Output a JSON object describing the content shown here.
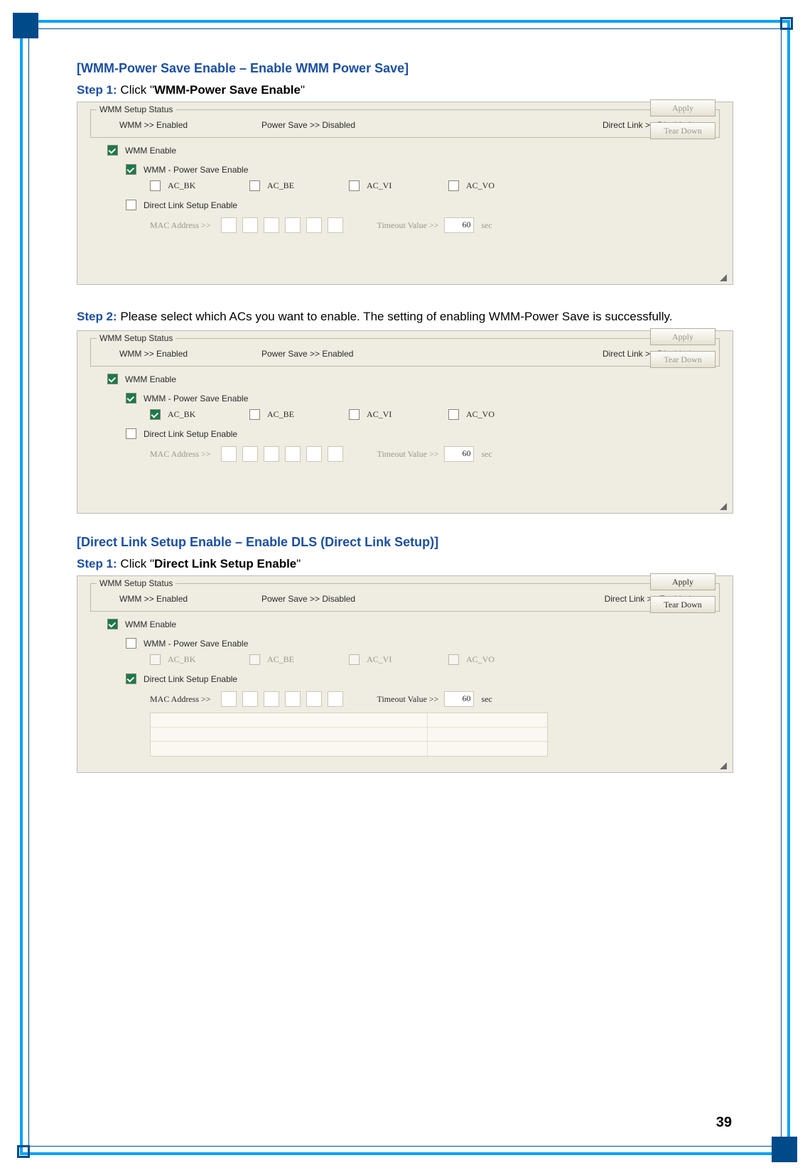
{
  "sectionA": {
    "heading": "[WMM-Power Save Enable – Enable WMM Power Save]",
    "step1_label": "Step 1:",
    "step1_normal": " Click \"",
    "step1_bold": "WMM-Power Save Enable",
    "step1_after": "\""
  },
  "panel1": {
    "group": "WMM Setup Status",
    "wmm": "WMM >> Enabled",
    "ps": "Power Save >> Disabled",
    "dl": "Direct Link >> Disabled",
    "wmm_enable": "WMM Enable",
    "ps_enable": "WMM - Power Save Enable",
    "ac_bk": "AC_BK",
    "ac_be": "AC_BE",
    "ac_vi": "AC_VI",
    "ac_vo": "AC_VO",
    "dls_enable": "Direct Link Setup Enable",
    "mac_label": "MAC Address >>",
    "tv_label": "Timeout Value >>",
    "tv_val": "60",
    "sec": "sec",
    "apply": "Apply",
    "tear": "Tear Down"
  },
  "step2_text_prefix": "Step 2:",
  "step2_text_rest": " Please select which ACs you want to enable. The setting of enabling WMM-Power Save is successfully.",
  "panel2": {
    "group": "WMM Setup Status",
    "wmm": "WMM >> Enabled",
    "ps": "Power Save >> Enabled",
    "dl": "Direct Link >> Disabled",
    "wmm_enable": "WMM Enable",
    "ps_enable": "WMM - Power Save Enable",
    "ac_bk": "AC_BK",
    "ac_be": "AC_BE",
    "ac_vi": "AC_VI",
    "ac_vo": "AC_VO",
    "dls_enable": "Direct Link Setup Enable",
    "mac_label": "MAC Address >>",
    "tv_label": "Timeout Value >>",
    "tv_val": "60",
    "sec": "sec",
    "apply": "Apply",
    "tear": "Tear Down"
  },
  "sectionB": {
    "heading": "[Direct Link Setup Enable – Enable DLS (Direct Link Setup)]",
    "step1_label": "Step 1:",
    "step1_normal": " Click \"",
    "step1_bold": "Direct Link Setup Enable",
    "step1_after": "\""
  },
  "panel3": {
    "group": "WMM Setup Status",
    "wmm": "WMM >> Enabled",
    "ps": "Power Save >> Disabled",
    "dl": "Direct Link >> Enabled",
    "wmm_enable": "WMM Enable",
    "ps_enable": "WMM - Power Save Enable",
    "ac_bk": "AC_BK",
    "ac_be": "AC_BE",
    "ac_vi": "AC_VI",
    "ac_vo": "AC_VO",
    "dls_enable": "Direct Link Setup Enable",
    "mac_label": "MAC Address >>",
    "tv_label": "Timeout Value >>",
    "tv_val": "60",
    "sec": "sec",
    "apply": "Apply",
    "tear": "Tear Down"
  },
  "page_number": "39"
}
